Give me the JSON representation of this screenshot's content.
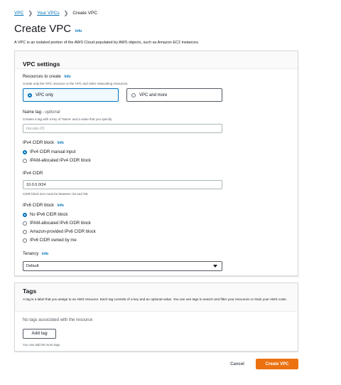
{
  "breadcrumb": {
    "vpc": "VPC",
    "your_vpcs": "Your VPCs",
    "current": "Create VPC",
    "sep": "❯"
  },
  "header": {
    "title": "Create VPC",
    "info": "Info",
    "description": "A VPC is an isolated portion of the AWS Cloud populated by AWS objects, such as Amazon EC2 instances."
  },
  "vpc_settings": {
    "title": "VPC settings",
    "resources": {
      "label": "Resources to create",
      "info": "Info",
      "hint": "Create only the VPC resource or the VPC and other networking resources.",
      "options": [
        "VPC only",
        "VPC and more"
      ],
      "selected": 0
    },
    "name_tag": {
      "label": "Name tag - ",
      "optional": "optional",
      "hint": "Creates a tag with a key of 'Name' and a value that you specify.",
      "placeholder": "my-vpc-01"
    },
    "ipv4_block": {
      "label": "IPv4 CIDR block",
      "info": "Info",
      "options": [
        "IPv4 CIDR manual input",
        "IPAM-allocated IPv4 CIDR block"
      ],
      "selected": 0
    },
    "ipv4_cidr": {
      "label": "IPv4 CIDR",
      "value": "10.0.0.0/24",
      "hint": "CIDR block size must be between /16 and /28."
    },
    "ipv6_block": {
      "label": "IPv6 CIDR block",
      "info": "Info",
      "options": [
        "No IPv6 CIDR block",
        "IPAM-allocated IPv6 CIDR block",
        "Amazon-provided IPv6 CIDR block",
        "IPv6 CIDR owned by me"
      ],
      "selected": 0
    },
    "tenancy": {
      "label": "Tenancy",
      "info": "Info",
      "value": "Default"
    }
  },
  "tags": {
    "title": "Tags",
    "description": "A tag is a label that you assign to an AWS resource. Each tag consists of a key and an optional value. You can use tags to search and filter your resources or track your AWS costs.",
    "empty": "No tags associated with the resource",
    "add_button": "Add tag",
    "hint": "You can add 50 more tags"
  },
  "footer": {
    "cancel": "Cancel",
    "create": "Create VPC"
  },
  "colors": {
    "primary": "#ec7211",
    "link": "#0073bb"
  }
}
